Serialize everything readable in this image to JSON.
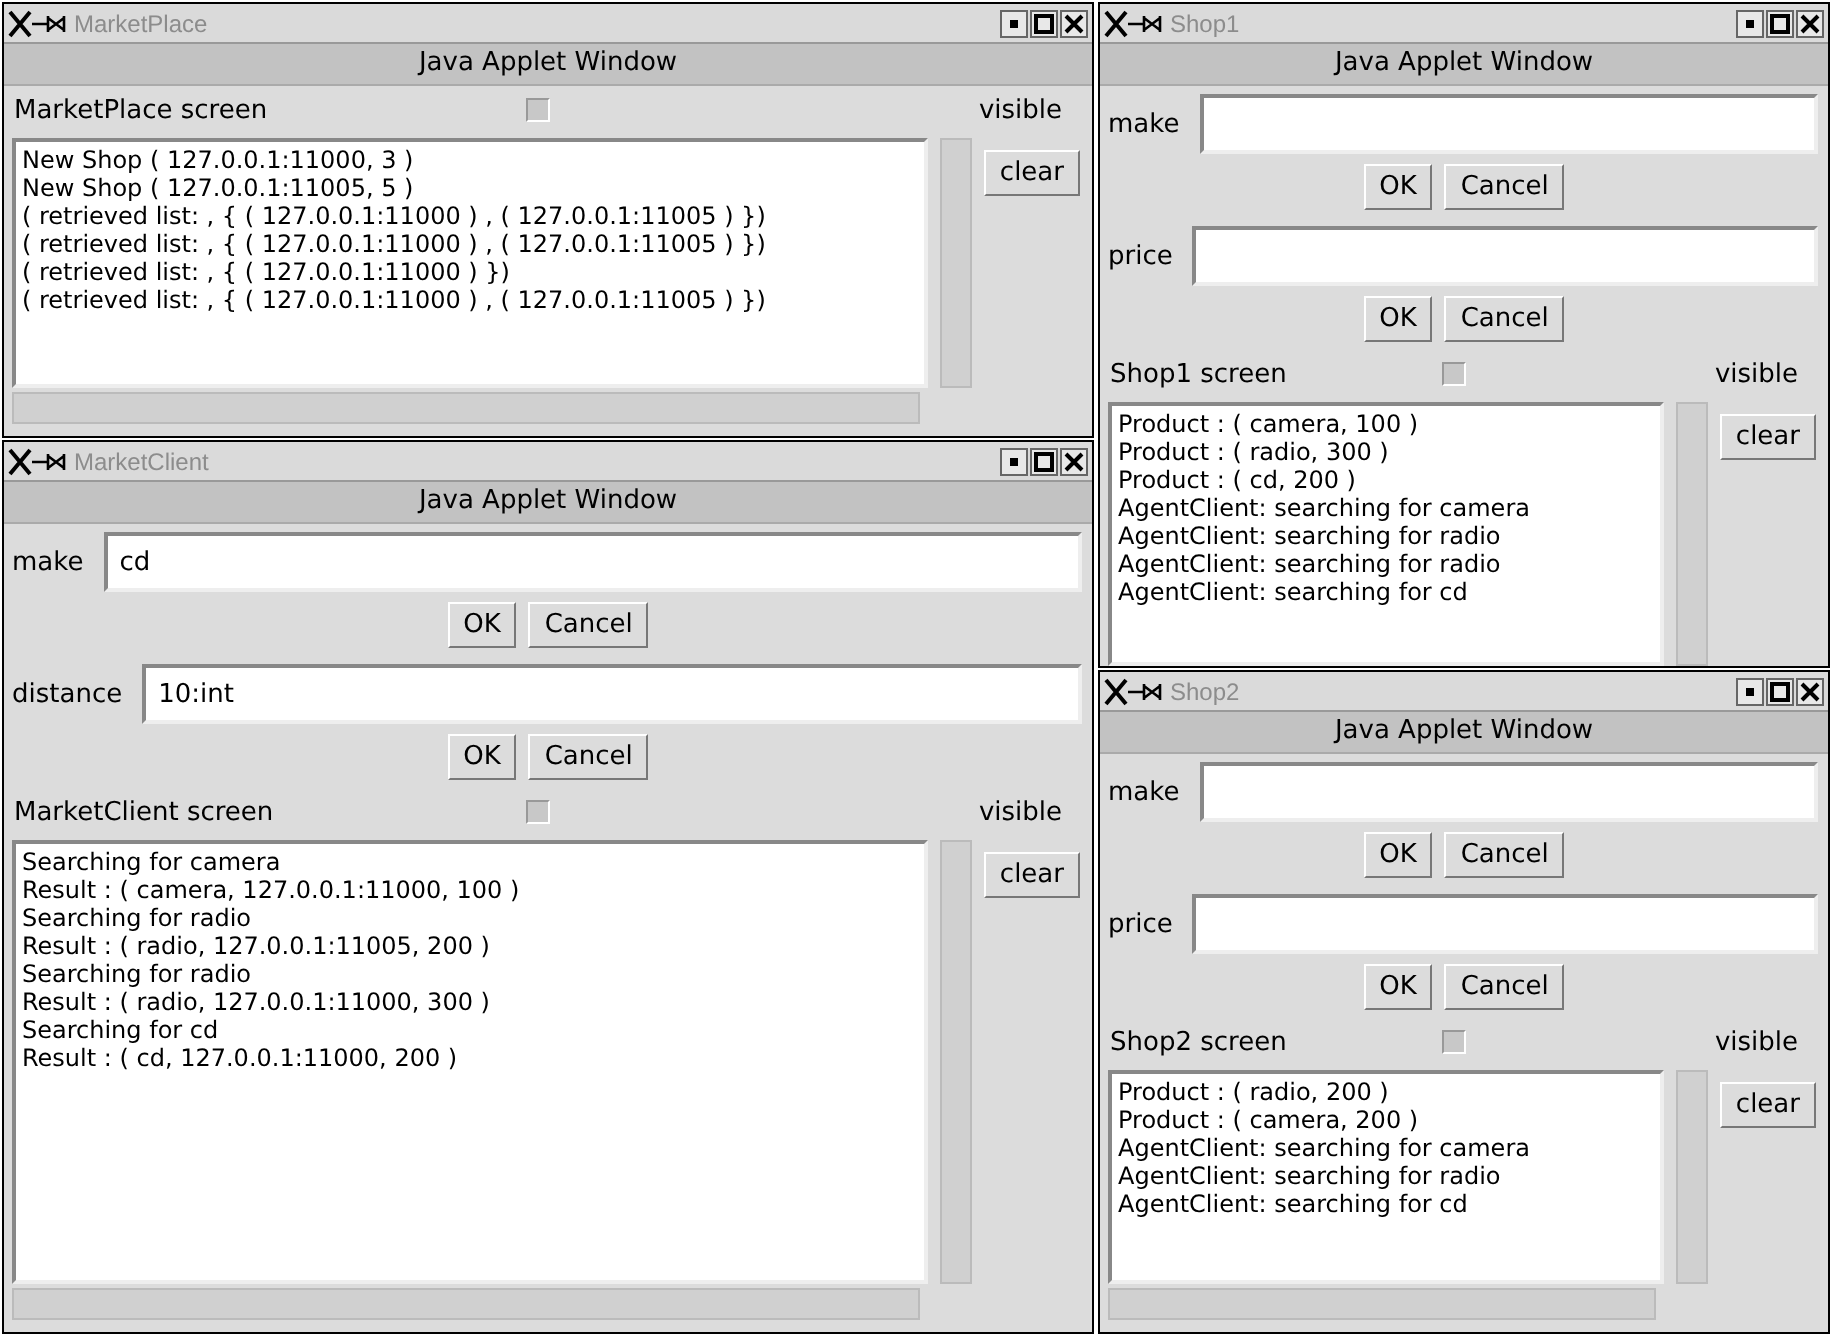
{
  "windows": [
    {
      "title": "MarketPlace",
      "banner": "Java Applet Window",
      "screen": {
        "label": "MarketPlace screen",
        "checked": false,
        "state_label": "visible"
      },
      "log": {
        "lines": [
          "New Shop ( 127.0.0.1:11000, 3 )",
          "New Shop ( 127.0.0.1:11005, 5 )",
          "( retrieved list: , { ( 127.0.0.1:11000 ) , ( 127.0.0.1:11005 ) })",
          "( retrieved list: , { ( 127.0.0.1:11000 ) , ( 127.0.0.1:11005 ) })",
          "( retrieved list: , { ( 127.0.0.1:11000 ) })",
          "( retrieved list: , { ( 127.0.0.1:11000 ) , ( 127.0.0.1:11005 ) })"
        ],
        "button": "clear"
      },
      "horizontal_scrollbar": true
    },
    {
      "title": "MarketClient",
      "banner": "Java Applet Window",
      "fields": [
        {
          "label": "make",
          "value": "cd",
          "ok": "OK",
          "cancel": "Cancel"
        },
        {
          "label": "distance",
          "value": "10:int",
          "ok": "OK",
          "cancel": "Cancel"
        }
      ],
      "screen": {
        "label": "MarketClient screen",
        "checked": false,
        "state_label": "visible"
      },
      "log": {
        "lines": [
          "Searching for camera",
          "Result : ( camera, 127.0.0.1:11000, 100 )",
          "Searching for radio",
          "Result : ( radio, 127.0.0.1:11005, 200 )",
          "Searching for radio",
          "Result : ( radio, 127.0.0.1:11000, 300 )",
          "Searching for cd",
          "Result : ( cd, 127.0.0.1:11000, 200 )"
        ],
        "button": "clear"
      },
      "horizontal_scrollbar": true
    },
    {
      "title": "Shop1",
      "banner": "Java Applet Window",
      "fields": [
        {
          "label": "make",
          "ok": "OK",
          "cancel": "Cancel"
        },
        {
          "label": "price",
          "ok": "OK",
          "cancel": "Cancel"
        }
      ],
      "screen": {
        "label": "Shop1 screen",
        "checked": false,
        "state_label": "visible"
      },
      "log": {
        "lines": [
          "Product : ( camera, 100 )",
          "Product : ( radio, 300 )",
          "Product : ( cd, 200 )",
          "AgentClient: searching for camera",
          "AgentClient: searching for radio",
          "AgentClient: searching for radio",
          "AgentClient: searching for cd"
        ],
        "button": "clear"
      },
      "horizontal_scrollbar": false
    },
    {
      "title": "Shop2",
      "banner": "Java Applet Window",
      "fields": [
        {
          "label": "make",
          "ok": "OK",
          "cancel": "Cancel"
        },
        {
          "label": "price",
          "ok": "OK",
          "cancel": "Cancel"
        }
      ],
      "screen": {
        "label": "Shop2 screen",
        "checked": false,
        "state_label": "visible"
      },
      "log": {
        "lines": [
          "Product : ( radio, 200 )",
          "Product : ( camera, 200 )",
          "AgentClient: searching for camera",
          "AgentClient: searching for radio",
          "AgentClient: searching for cd"
        ],
        "button": "clear"
      },
      "horizontal_scrollbar": true
    }
  ]
}
